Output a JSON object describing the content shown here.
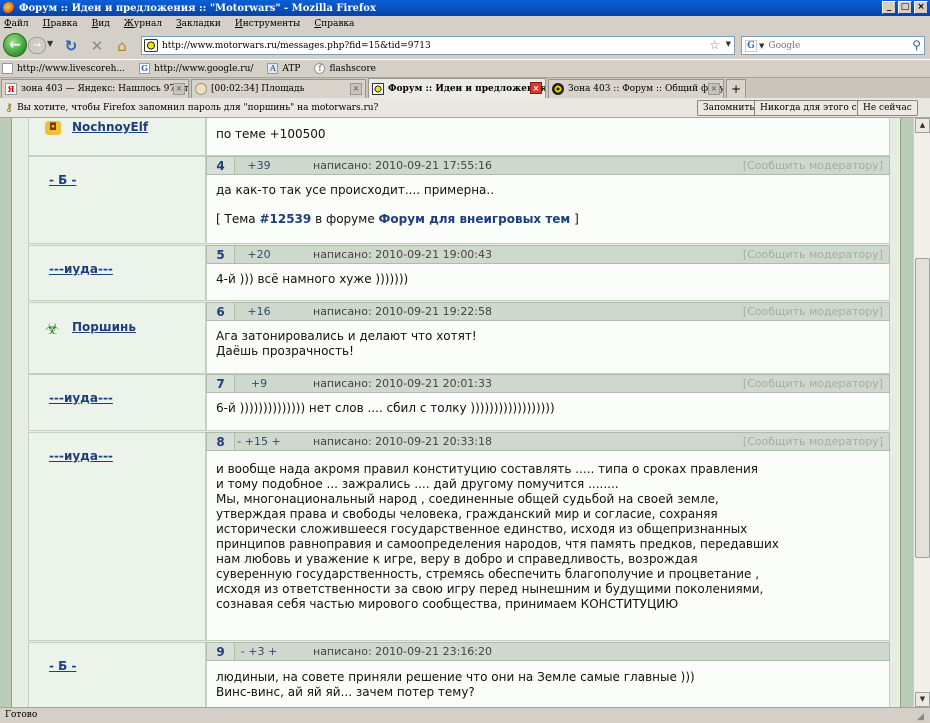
{
  "window": {
    "title": "Форум :: Идеи и предложения :: \"Motorwars\" - Mozilla Firefox"
  },
  "menu": [
    "Файл",
    "Правка",
    "Вид",
    "Журнал",
    "Закладки",
    "Инструменты",
    "Справка"
  ],
  "nav": {
    "url": "http://www.motorwars.ru/messages.php?fid=15&tid=9713",
    "search_placeholder": "Google",
    "search_engine_glyph": "G"
  },
  "bookmarks": [
    {
      "label": "http://www.livescoreh...",
      "icon": "page-icon",
      "glyph": ""
    },
    {
      "label": "http://www.google.ru/",
      "icon": "google-icon",
      "glyph": "G"
    },
    {
      "label": "ATP",
      "icon": "atp-icon",
      "glyph": "A"
    },
    {
      "label": "flashscore",
      "icon": "flashscore-icon",
      "glyph": "f"
    }
  ],
  "tabs": [
    {
      "label": "зона 403 — Яндекс: Нашлось 978 тыс...",
      "icon": "yandex-icon",
      "glyph": "Я",
      "active": false
    },
    {
      "label": "[00:02:34] Площадь",
      "icon": "download-icon",
      "glyph": "",
      "active": false
    },
    {
      "label": "Форум :: Идеи и предложения :: \"...",
      "icon": "motorwars-icon",
      "glyph": "",
      "active": true
    },
    {
      "label": "Зона 403 :: Форум :: Общий форум",
      "icon": "radiation-icon",
      "glyph": "",
      "active": false
    }
  ],
  "password_bar": {
    "text": "Вы хотите, чтобы Firefox запомнил пароль для \"поршинь\" на motorwars.ru?",
    "remember": "Запомнить",
    "never": "Никогда для этого сайта",
    "not_now": "Не сейчас"
  },
  "posts": [
    {
      "author": "NochnoyElf",
      "number": "",
      "rating": "",
      "date": "",
      "report": "",
      "lines": [
        "по теме +100500"
      ],
      "topic": null
    },
    {
      "author": "- Б -",
      "number": "4",
      "rating": "+39",
      "date": "написано: 2010-09-21 17:55:16",
      "report": "[Сообщить модератору]",
      "lines": [
        "да как-то так усе происходит.... примерна.."
      ],
      "topic": {
        "prefix": "[ Тема ",
        "id": "#12539",
        "middle": " в форуме ",
        "forum": "Форум для внеигровых тем",
        "suffix": " ]"
      }
    },
    {
      "author": "---иуда---",
      "number": "5",
      "rating": "+20",
      "date": "написано: 2010-09-21 19:00:43",
      "report": "[Сообщить модератору]",
      "lines": [
        "4-й ))) всё намного хуже )))))))"
      ],
      "topic": null
    },
    {
      "author": "Поршинь",
      "number": "6",
      "rating": "+16",
      "date": "написано: 2010-09-21 19:22:58",
      "report": "[Сообщить модератору]",
      "lines": [
        "Ага затонировались и делают что хотят!",
        "Даёшь прозрачность!"
      ],
      "topic": null
    },
    {
      "author": "---иуда---",
      "number": "7",
      "rating": "+9",
      "date": "написано: 2010-09-21 20:01:33",
      "report": "[Сообщить модератору]",
      "lines": [
        "6-й )))))))))))))) нет слов .... сбил с толку ))))))))))))))))))"
      ],
      "topic": null
    },
    {
      "author": "---иуда---",
      "number": "8",
      "rating": "- +15 +",
      "date": "написано: 2010-09-21 20:33:18",
      "report": "[Сообщить модератору]",
      "lines": [
        "и вообще нада акромя правил конституцию составлять ..... типа о сроках правления",
        "и тому подобное ... зажрались .... дай другому помучится ........",
        "Мы, многонациональный народ , соединенные общей судьбой на своей земле,",
        "утверждая права и свободы человека, гражданский мир и согласие, сохраняя",
        "исторически сложившееся государственное единство, исходя из общепризнанных",
        "принципов равноправия и самоопределения народов, чтя память предков, передавших",
        "нам любовь и уважение к игре, веру в добро и справедливость, возрождая",
        "суверенную государственность, стремясь обеспечить благополучие и процветание ,",
        "исходя из ответственности за свою игру перед нынешним и будущими поколениями,",
        "сознавая себя частью мирового сообщества, принимаем КОНСТИТУЦИЮ"
      ],
      "topic": null
    },
    {
      "author": "- Б -",
      "number": "9",
      "rating": "- +3 +",
      "date": "написано: 2010-09-21 23:16:20",
      "report": "",
      "lines": [
        "людиныи, на совете приняли решение что они на Земле самые главные )))",
        "Винс-винс, ай яй яй... зачем потер тему?"
      ],
      "topic": null
    }
  ],
  "status": "Готово"
}
